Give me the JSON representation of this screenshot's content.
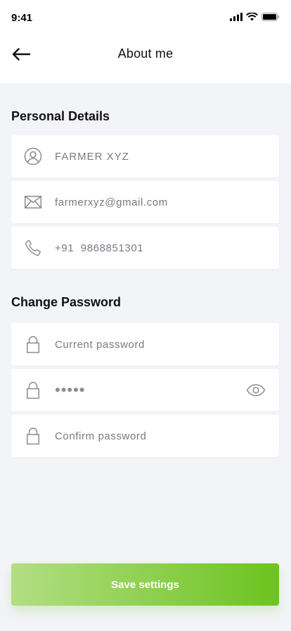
{
  "status_bar": {
    "time": "9:41"
  },
  "header": {
    "title": "About me"
  },
  "personal_details": {
    "title": "Personal Details",
    "name_value": "FARMER XYZ",
    "email_value": "farmerxyz@gmail.com",
    "phone_value": "+91  9868851301"
  },
  "change_password": {
    "title": "Change Password",
    "current_placeholder": "Current password",
    "new_value_masked": "•••••",
    "confirm_placeholder": "Confirm password"
  },
  "actions": {
    "save_label": "Save settings"
  },
  "colors": {
    "background": "#f3f4f8",
    "card": "#ffffff",
    "button_gradient_start": "#b2de84",
    "button_gradient_end": "#6cc41f",
    "text_muted": "#777a80"
  },
  "icons": {
    "back": "arrow-left-icon",
    "user": "user-circle-icon",
    "mail": "mail-icon",
    "phone": "phone-icon",
    "lock": "lock-icon",
    "eye": "eye-icon"
  }
}
